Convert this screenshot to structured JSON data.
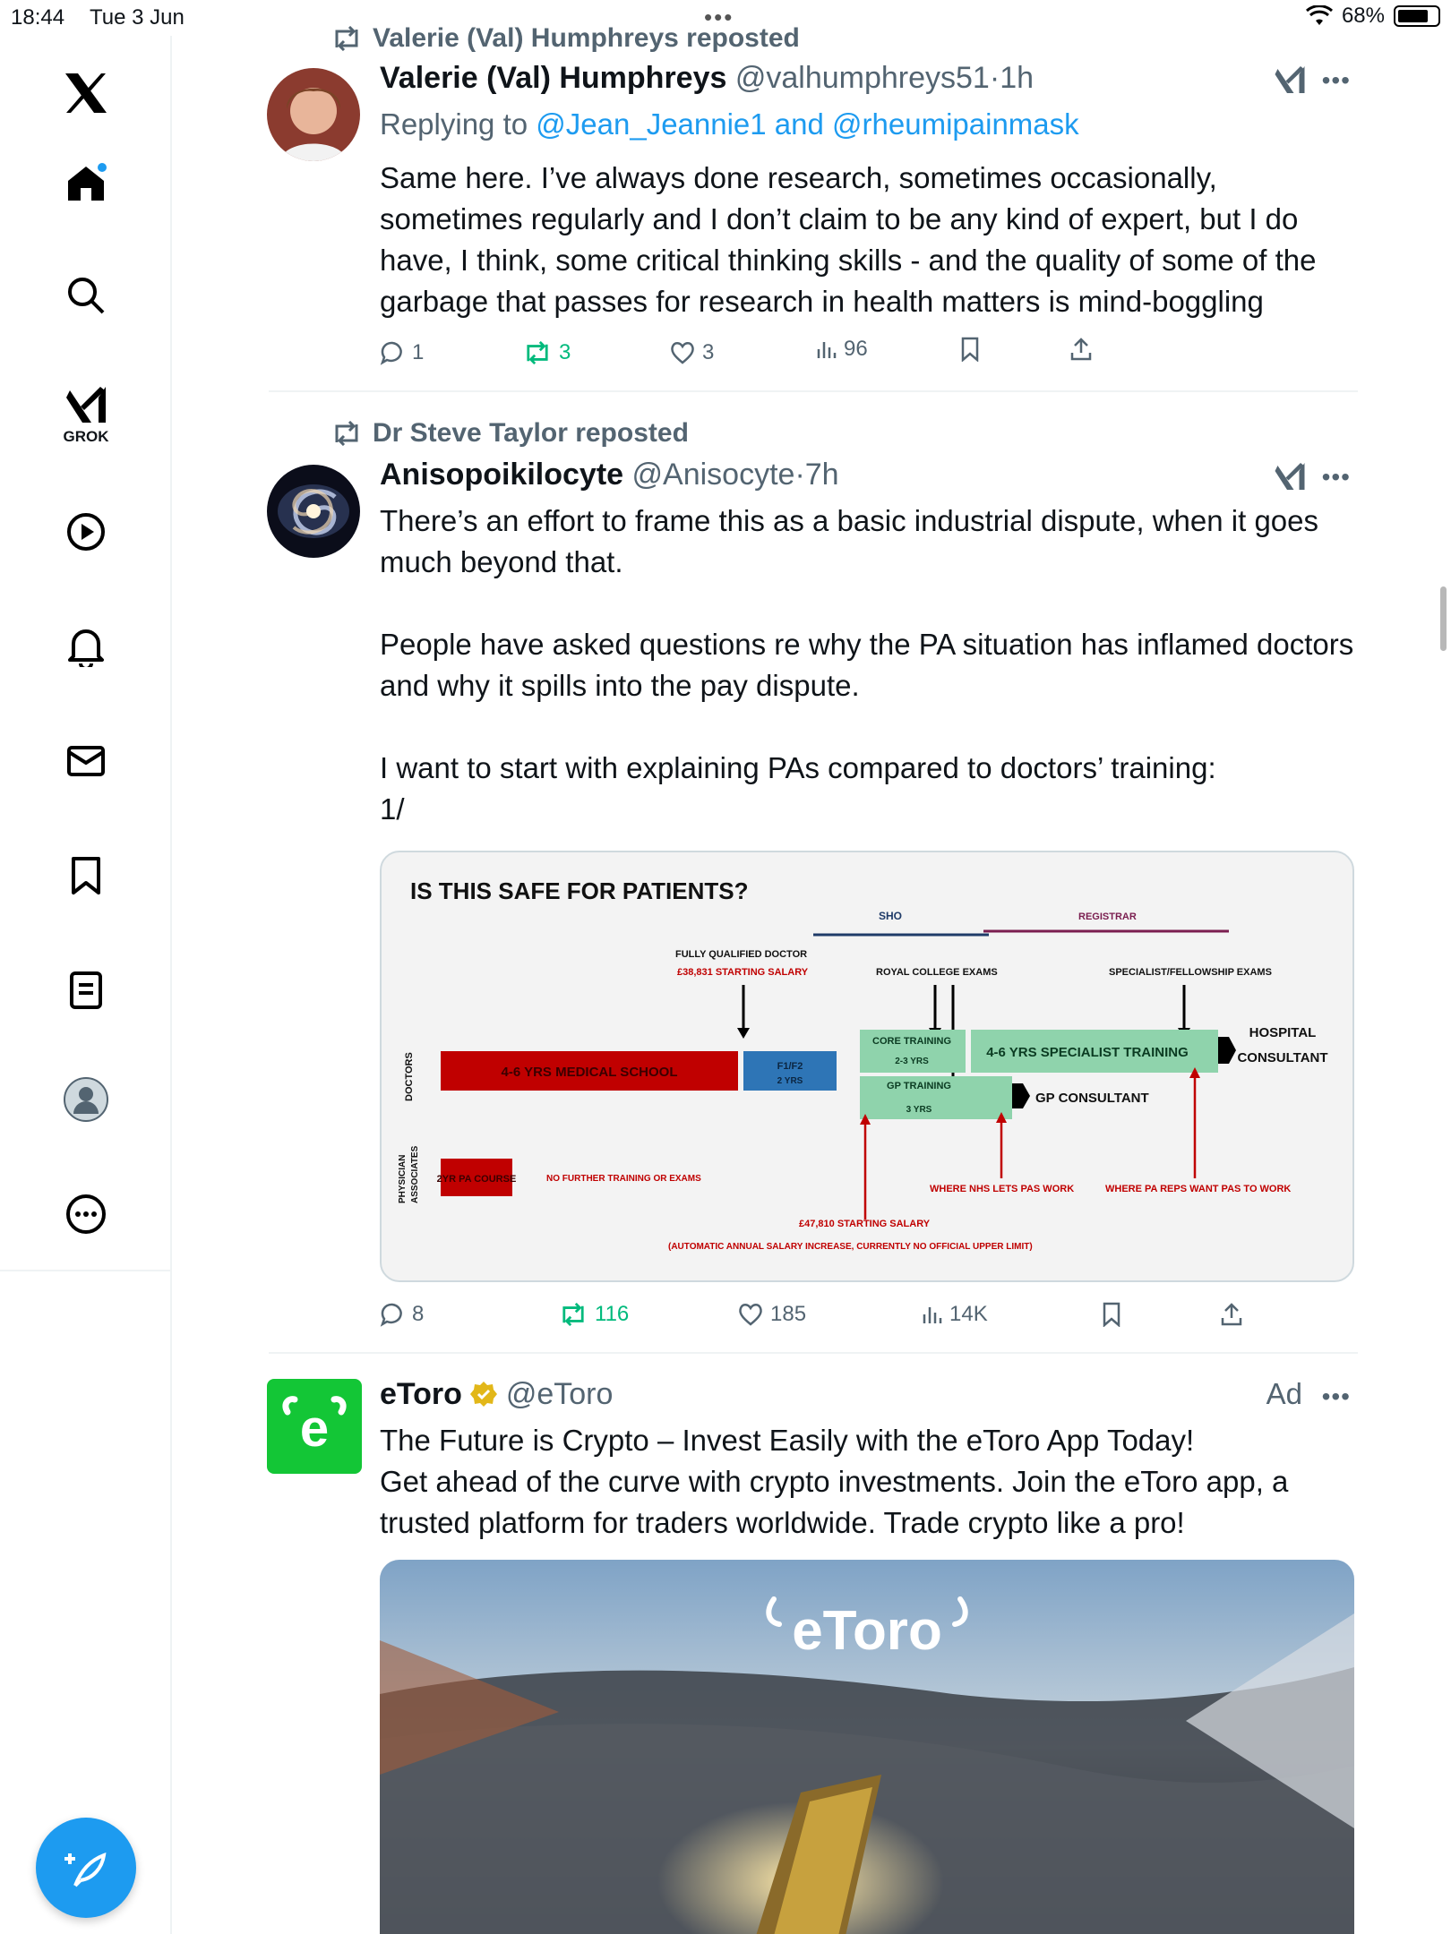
{
  "status": {
    "time": "18:44",
    "date": "Tue 3 Jun",
    "battery": "68%",
    "battery_level": 0.68
  },
  "sidebar": {
    "grok_label": "GROK",
    "items": [
      "x-logo",
      "home",
      "search",
      "grok",
      "video",
      "notifications",
      "messages",
      "bookmarks",
      "lists",
      "profile",
      "more"
    ]
  },
  "posts": [
    {
      "reposted_by": "Valerie (Val) Humphreys reposted",
      "name": "Valerie (Val) Humphreys",
      "handle": "@valhumphreys51",
      "sep": "·",
      "time": "1h",
      "reply_prefix": "Replying to",
      "reply_users": "@Jean_Jeannie1 and @rheumipainmask",
      "text": "Same here. I’ve always done research, sometimes occasionally, sometimes regularly and I don’t claim to be any kind of expert, but I do have, I think, some critical thinking skills - and the quality of some of the garbage that passes for research in health matters is mind-boggling",
      "replies": "1",
      "reposts": "3",
      "likes": "3",
      "views": "96"
    },
    {
      "reposted_by": "Dr Steve Taylor reposted",
      "name": "Anisopoikilocyte",
      "handle": "@Anisocyte",
      "sep": "·",
      "time": "7h",
      "text": "There’s an effort to frame this as a basic industrial dispute, when it goes much beyond that.\n\nPeople have asked questions re why the PA situation has inflamed doctors and why it spills into the pay dispute.\n\nI want to start with explaining PAs compared to doctors’ training:\n1/",
      "replies": "8",
      "reposts": "116",
      "likes": "185",
      "views": "14K"
    }
  ],
  "chart": {
    "title": "IS THIS SAFE FOR PATIENTS?",
    "sho": "SHO",
    "registrar": "REGISTRAR",
    "fully_qualified": "FULLY QUALIFIED DOCTOR",
    "starting_salary_doctor": "£38,831 STARTING SALARY",
    "royal_college": "ROYAL COLLEGE EXAMS",
    "specialist_exams": "SPECIALIST/FELLOWSHIP EXAMS",
    "doctors_label": "DOCTORS",
    "pa_label_1": "PHYSICIAN",
    "pa_label_2": "ASSOCIATES",
    "med_school": "4-6 YRS MEDICAL SCHOOL",
    "f1f2": "F1/F2",
    "f1f2_yrs": "2 YRS",
    "core_training": "CORE TRAINING",
    "core_yrs": "2-3 YRS",
    "gp_training": "GP TRAINING",
    "gp_yrs": "3 YRS",
    "specialist_training": "4-6 YRS SPECIALIST TRAINING",
    "hospital_consultant_1": "HOSPITAL",
    "hospital_consultant_2": "CONSULTANT",
    "gp_consultant": "GP CONSULTANT",
    "pa_course": "2YR PA COURSE",
    "no_further": "NO FURTHER TRAINING OR EXAMS",
    "where_nhs": "WHERE NHS LETS PAS WORK",
    "where_pa_reps": "WHERE PA REPS WANT PAS TO WORK",
    "pa_salary": "£47,810 STARTING SALARY",
    "pa_salary_note": "(AUTOMATIC ANNUAL SALARY INCREASE, CURRENTLY NO OFFICIAL UPPER LIMIT)"
  },
  "ad": {
    "name": "eToro",
    "handle": "@eToro",
    "label": "Ad",
    "text": "The Future is Crypto – Invest Easily with the eToro App Today!\nGet ahead of the curve with crypto investments. Join the eToro app, a trusted platform for traders worldwide. Trade crypto like a pro!",
    "media_logo": "eToro"
  },
  "colors": {
    "accent": "#1d9bf0",
    "repost_green": "#00ba7c",
    "muted": "#536471",
    "etoro_green": "#13c636"
  }
}
